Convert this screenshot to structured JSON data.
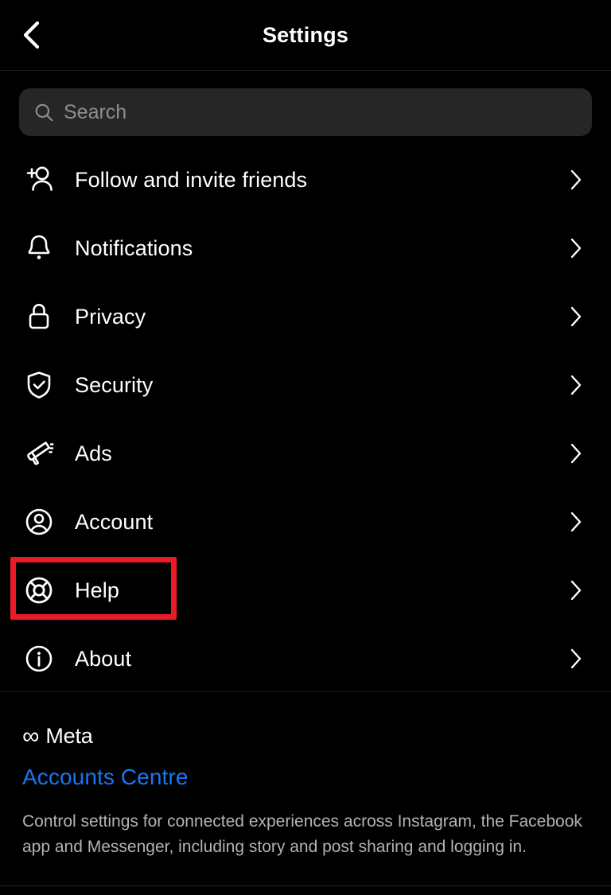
{
  "header": {
    "title": "Settings",
    "back_icon": "chevron-left-icon"
  },
  "search": {
    "placeholder": "Search",
    "value": "",
    "icon": "search-icon"
  },
  "menu": {
    "items": [
      {
        "label": "Follow and invite friends",
        "icon": "person-add-icon",
        "chevron": "chevron-right-icon",
        "highlighted": false
      },
      {
        "label": "Notifications",
        "icon": "bell-icon",
        "chevron": "chevron-right-icon",
        "highlighted": false
      },
      {
        "label": "Privacy",
        "icon": "lock-icon",
        "chevron": "chevron-right-icon",
        "highlighted": false
      },
      {
        "label": "Security",
        "icon": "shield-check-icon",
        "chevron": "chevron-right-icon",
        "highlighted": false
      },
      {
        "label": "Ads",
        "icon": "megaphone-icon",
        "chevron": "chevron-right-icon",
        "highlighted": false
      },
      {
        "label": "Account",
        "icon": "account-circle-icon",
        "chevron": "chevron-right-icon",
        "highlighted": false
      },
      {
        "label": "Help",
        "icon": "life-ring-icon",
        "chevron": "chevron-right-icon",
        "highlighted": true
      },
      {
        "label": "About",
        "icon": "info-circle-icon",
        "chevron": "chevron-right-icon",
        "highlighted": false
      }
    ]
  },
  "footer": {
    "brand_mark": "∞",
    "brand_name": "Meta",
    "link_label": "Accounts Centre",
    "description": "Control settings for connected experiences across Instagram, the Facebook app and Messenger, including story and post sharing and logging in."
  },
  "colors": {
    "background": "#000000",
    "text_primary": "#ffffff",
    "text_secondary": "#b3b3b3",
    "placeholder": "#8e8e8e",
    "search_bg": "#262626",
    "link_blue": "#1877F2",
    "highlight_red": "#E81B26",
    "divider": "#1c1c1c"
  }
}
